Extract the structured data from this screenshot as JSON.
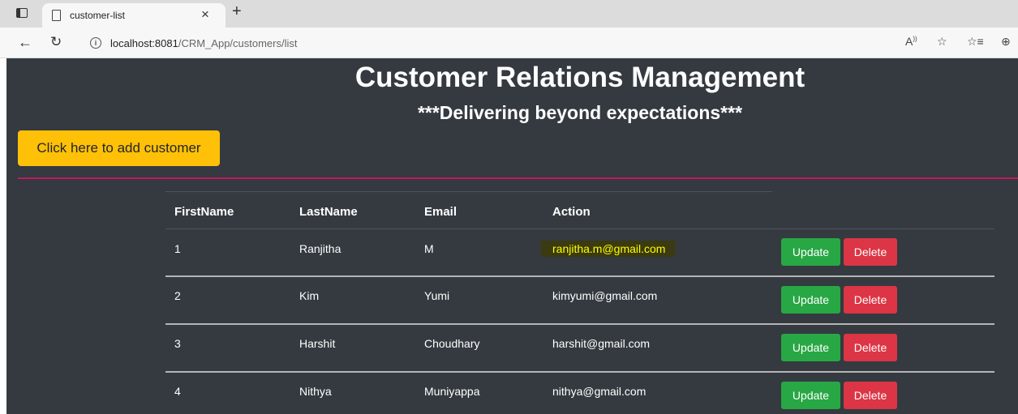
{
  "browser": {
    "tab_title": "customer-list",
    "url_host": "localhost:8081",
    "url_path": "/CRM_App/customers/list"
  },
  "header": {
    "title": "Customer Relations Management",
    "subtitle": "***Delivering beyond expectations***"
  },
  "add_button_label": "Click here to add customer",
  "table": {
    "columns": [
      "FirstName",
      "LastName",
      "Email",
      "Action"
    ],
    "rows": [
      {
        "id": "1",
        "first": "Ranjitha",
        "last": "M",
        "email": "ranjitha.m@gmail.com",
        "highlighted": true
      },
      {
        "id": "2",
        "first": "Kim",
        "last": "Yumi",
        "email": "kimyumi@gmail.com",
        "highlighted": false
      },
      {
        "id": "3",
        "first": "Harshit",
        "last": "Choudhary",
        "email": "harshit@gmail.com",
        "highlighted": false
      },
      {
        "id": "4",
        "first": "Nithya",
        "last": "Muniyappa",
        "email": "nithya@gmail.com",
        "highlighted": false
      }
    ],
    "update_label": "Update",
    "delete_label": "Delete"
  },
  "colors": {
    "page_bg": "#343a40",
    "add_button": "#ffc107",
    "divider": "#c2185b",
    "update": "#28a745",
    "delete": "#dc3545",
    "highlight_text": "#ffff00"
  }
}
